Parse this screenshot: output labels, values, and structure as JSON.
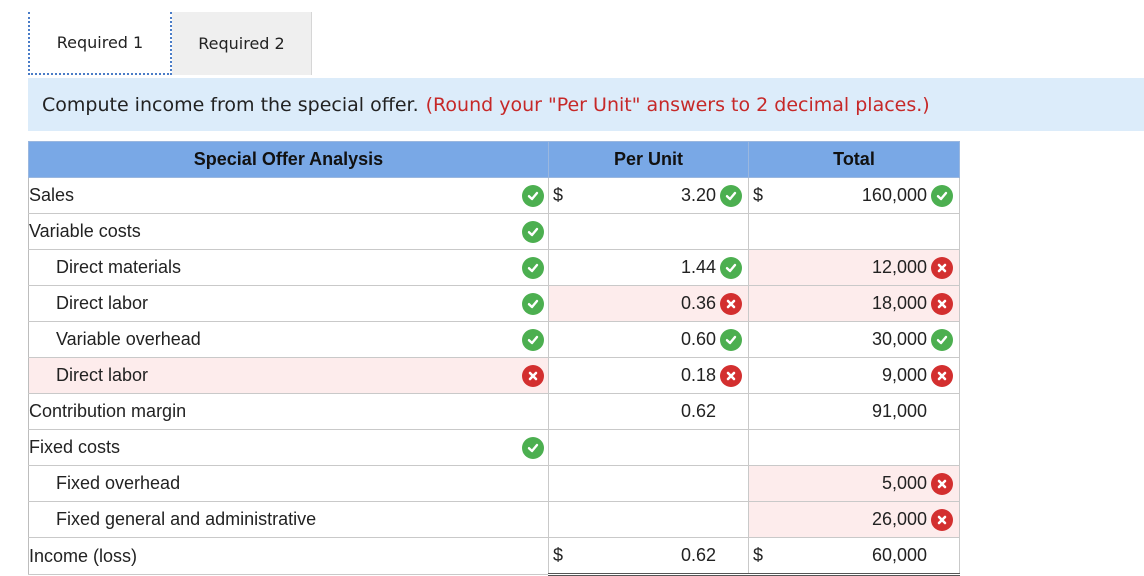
{
  "tabs": [
    {
      "label": "Required 1",
      "active": true
    },
    {
      "label": "Required 2",
      "active": false
    }
  ],
  "instruction": {
    "text": "Compute income from the special offer.",
    "note": "(Round your \"Per Unit\" answers to 2 decimal places.)"
  },
  "table": {
    "headers": {
      "label": "Special Offer Analysis",
      "per_unit": "Per Unit",
      "total": "Total"
    },
    "rows": [
      {
        "label": "Sales",
        "label_status": "check",
        "per_unit": "3.20",
        "per_unit_status": "check",
        "per_unit_dollar": "$",
        "total": "160,000",
        "total_status": "check",
        "total_dollar": "$"
      },
      {
        "label": "Variable costs",
        "label_status": "check",
        "per_unit": "",
        "per_unit_status": "",
        "per_unit_dollar": "",
        "total": "",
        "total_status": "",
        "total_dollar": ""
      },
      {
        "label": "Direct materials",
        "label_status": "check",
        "per_unit": "1.44",
        "per_unit_status": "check",
        "per_unit_dollar": "",
        "total": "12,000",
        "total_status": "cross",
        "total_dollar": ""
      },
      {
        "label": "Direct labor",
        "label_status": "check",
        "per_unit": "0.36",
        "per_unit_status": "cross",
        "per_unit_dollar": "",
        "total": "18,000",
        "total_status": "cross",
        "total_dollar": ""
      },
      {
        "label": "Variable overhead",
        "label_status": "check",
        "per_unit": "0.60",
        "per_unit_status": "check",
        "per_unit_dollar": "",
        "total": "30,000",
        "total_status": "check",
        "total_dollar": ""
      },
      {
        "label": "Direct labor",
        "label_status": "cross",
        "per_unit": "0.18",
        "per_unit_status": "cross",
        "per_unit_dollar": "",
        "total": "9,000",
        "total_status": "cross",
        "total_dollar": ""
      },
      {
        "label": "Contribution margin",
        "label_status": "",
        "per_unit": "0.62",
        "per_unit_status": "",
        "per_unit_dollar": "",
        "total": "91,000",
        "total_status": "",
        "total_dollar": ""
      },
      {
        "label": "Fixed costs",
        "label_status": "check",
        "per_unit": "",
        "per_unit_status": "",
        "per_unit_dollar": "",
        "total": "",
        "total_status": "",
        "total_dollar": ""
      },
      {
        "label": "Fixed overhead",
        "label_status": "",
        "per_unit": "",
        "per_unit_status": "",
        "per_unit_dollar": "",
        "total": "5,000",
        "total_status": "cross",
        "total_dollar": ""
      },
      {
        "label": "Fixed general and administrative",
        "label_status": "",
        "per_unit": "",
        "per_unit_status": "",
        "per_unit_dollar": "",
        "total": "26,000",
        "total_status": "cross",
        "total_dollar": ""
      },
      {
        "label": "Income (loss)",
        "label_status": "",
        "per_unit": "0.62",
        "per_unit_status": "",
        "per_unit_dollar": "$",
        "total": "60,000",
        "total_status": "",
        "total_dollar": "$"
      }
    ]
  },
  "icons": {
    "check": "check-circle-icon",
    "cross": "cross-circle-icon"
  },
  "colors": {
    "check": "#4caf50",
    "cross": "#d32f2f",
    "header_bg": "#79a8e6",
    "instruction_bg": "#dcecfa",
    "note": "#c62828",
    "error_bg": "#fdecec"
  }
}
